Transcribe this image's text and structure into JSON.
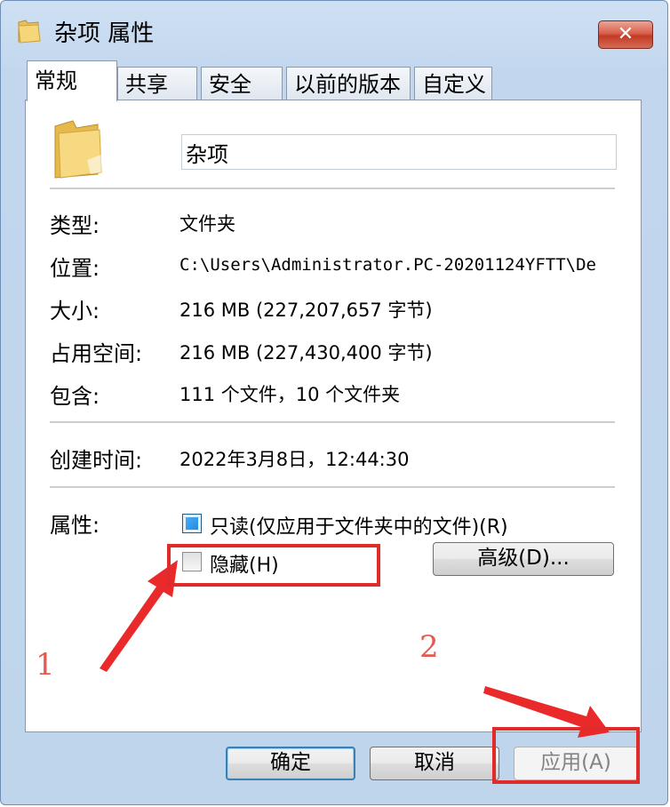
{
  "window": {
    "title": "杂项 属性",
    "close_label": "✕"
  },
  "tabs": [
    {
      "label": "常规",
      "active": true
    },
    {
      "label": "共享",
      "active": false
    },
    {
      "label": "安全",
      "active": false
    },
    {
      "label": "以前的版本",
      "active": false
    },
    {
      "label": "自定义",
      "active": false
    }
  ],
  "general": {
    "folder_name": "杂项",
    "type_label": "类型:",
    "type_value": "文件夹",
    "location_label": "位置:",
    "location_value": "C:\\Users\\Administrator.PC-20201124YFTT\\De",
    "size_label": "大小:",
    "size_value": "216 MB (227,207,657 字节)",
    "size_on_disk_label": "占用空间:",
    "size_on_disk_value": "216 MB (227,430,400 字节)",
    "contains_label": "包含:",
    "contains_value": "111 个文件，10 个文件夹",
    "created_label": "创建时间:",
    "created_value": "2022年3月8日，12:44:30",
    "attributes_label": "属性:",
    "readonly_label": "只读(仅应用于文件夹中的文件)(R)",
    "readonly_checked": true,
    "hidden_label": "隐藏(H)",
    "hidden_checked": false,
    "advanced_label": "高级(D)..."
  },
  "buttons": {
    "ok": "确定",
    "cancel": "取消",
    "apply": "应用(A)"
  },
  "annotations": {
    "step1": "1",
    "step2": "2",
    "color": "#e02b2b"
  }
}
